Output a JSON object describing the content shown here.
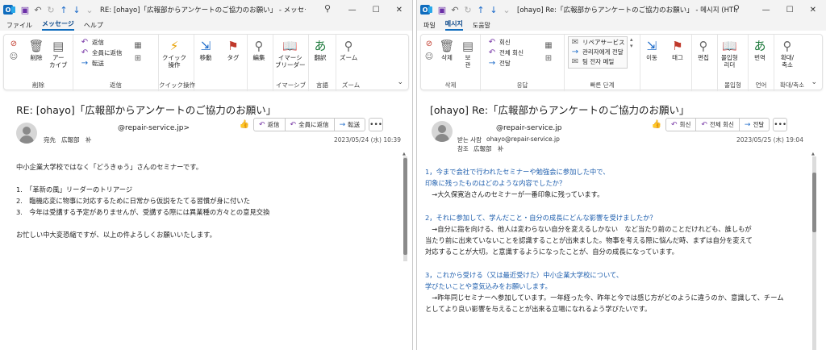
{
  "left": {
    "title": "RE: [ohayo]「広報部からアンケートのご協力のお願い」 - メッセージ (HTML…",
    "window_controls": [
      "—",
      "☐",
      "✕"
    ],
    "menus": [
      "ファイル",
      "メッセージ",
      "ヘルプ"
    ],
    "active_menu": 1,
    "ribbon": {
      "delete_group": "削除",
      "delete": "削除",
      "archive": "アー\nカイブ",
      "reply_group": "返信",
      "reply": "返信",
      "reply_all": "全員に返信",
      "forward": "転送",
      "quick_group": "クイック操作",
      "quick_steps": "クイック\n操作",
      "move": "移動",
      "tags": "タグ",
      "edit": "編集",
      "immersive": "イマーシ\nブリーダー",
      "immersive_group": "イマーシブ",
      "translate": "翻訳",
      "lang_group": "言語",
      "zoom": "ズーム",
      "zoom_group": "ズーム"
    },
    "subject": "RE: [ohayo]「広報部からアンケートのご協力のお願い」",
    "from_addr": "@repair-service.jp>",
    "to_label": "宛先",
    "to_value": "広報部　补",
    "date": "2023/05/24 (水) 10:39",
    "actions": {
      "reply": "返信",
      "reply_all": "全員に返信",
      "forward": "転送"
    },
    "body": [
      "中小企業大学校ではなく「どうきゅう」さんのセミナーです。",
      "",
      "1.　「革新の風」リーダーのトリアージ",
      "2.　臨機応変に物事に対応するために日常から仮説をたてる習慣が身に付いた",
      "3.　今年は受講する予定がありませんが、受講する際には異業種の方々との意見交換",
      "",
      "お忙しい中大変恐縮ですが、以上の件よろしくお願いいたします。"
    ]
  },
  "right": {
    "title": "[ohayo] Re:「広報部からアンケートのご協力のお願い」 - 메시지 (HTML)",
    "window_controls": [
      "—",
      "☐",
      "✕"
    ],
    "menus": [
      "파일",
      "메시지",
      "도움말"
    ],
    "active_menu": 1,
    "ribbon": {
      "delete_group": "삭제",
      "delete": "삭제",
      "archive": "보\n관",
      "reply_group": "응답",
      "reply": "회신",
      "reply_all": "전체 회신",
      "forward": "전달",
      "quick_group": "빠른 단계",
      "quick1": "リペアサービス",
      "quick2": "관리자에게 전달",
      "quick3": "팀 전자 메일",
      "move": "이동",
      "tags": "태그",
      "edit": "편집",
      "immersive": "몰입형\n리더",
      "immersive_group": "몰입형",
      "translate": "번역",
      "lang_group": "언어",
      "zoom": "확대/\n축소",
      "zoom_group": "확대/축소"
    },
    "subject": "[ohayo] Re:「広報部からアンケートのご協力のお願い」",
    "from_addr": "@repair-service.jp",
    "sender_label": "받는 사람",
    "sender_value": "ohayo@repair-service.jp",
    "cc_label": "참조",
    "cc_value": "広報部　补",
    "date": "2023/05/25 (木) 19:04",
    "actions": {
      "reply": "회신",
      "reply_all": "전체 회신",
      "forward": "전달"
    },
    "body": [
      {
        "t": "1，今まで会社で行われたセミナーや勉強会に参加した中で、",
        "q": true
      },
      {
        "t": "印象に残ったものはどのような内容でしたか？",
        "q": true
      },
      {
        "t": "　→大久保寛治さんのセミナーが一番印象に残っています。",
        "q": false
      },
      {
        "t": "",
        "q": false
      },
      {
        "t": "2，それに参加して、学んだこと・自分の成長にどんな影響を受けましたか？",
        "q": true
      },
      {
        "t": "　→自分に指を向ける、他人は変わらない自分を変えるしかない　など当たり前のことだけれども、誰しもが",
        "q": false
      },
      {
        "t": "当たり前に出来ていないことを認識することが出来ました。物事を考える際に悩んだ時、まずは自分を変えて",
        "q": false
      },
      {
        "t": "対応することが大切。と意識するようになったことが、自分の成長になっています。",
        "q": false
      },
      {
        "t": "",
        "q": false
      },
      {
        "t": "3，これから受ける（又は最近受けた）中小企業大学校について、",
        "q": true
      },
      {
        "t": "学びたいことや意気込みをお願いします。",
        "q": true
      },
      {
        "t": "　→昨年同じセミナーへ参加しています。一年経った今、昨年と今では感じ方がどのように違うのか、意識して、チーム",
        "q": false
      },
      {
        "t": "としてより良い影響を与えることが出来る立場になれるよう学びたいです。",
        "q": false
      }
    ]
  }
}
